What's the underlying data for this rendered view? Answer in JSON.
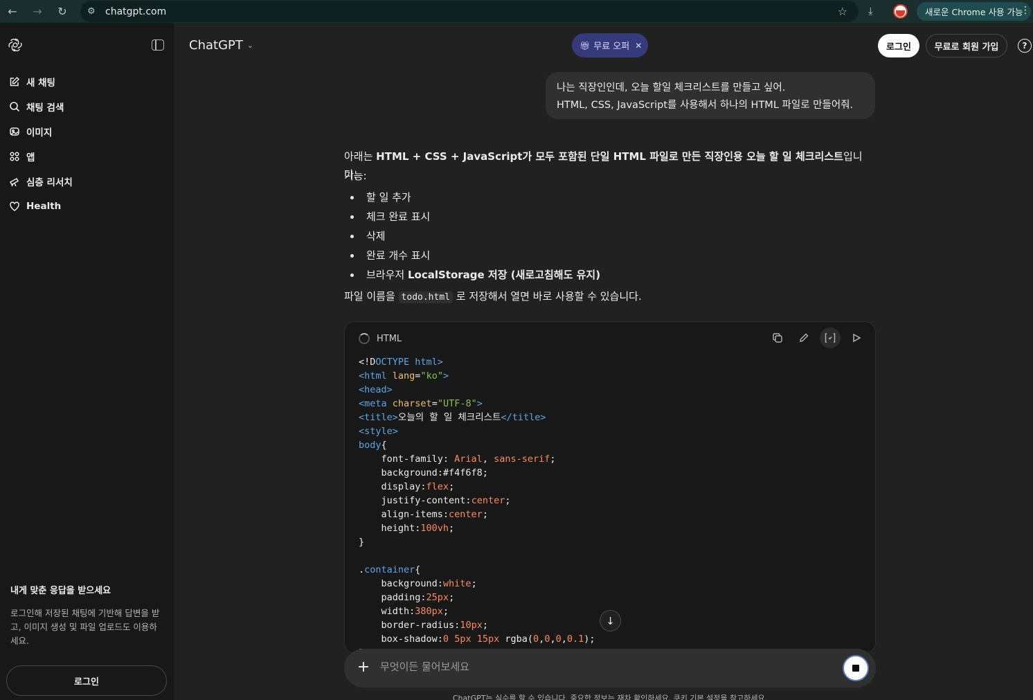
{
  "browser": {
    "url": "chatgpt.com",
    "update_label": "새로운 Chrome 사용 가능"
  },
  "sidebar": {
    "items": [
      {
        "label": "새 채팅",
        "icon": "edit-icon"
      },
      {
        "label": "채팅 검색",
        "icon": "search-icon"
      },
      {
        "label": "이미지",
        "icon": "image-icon"
      },
      {
        "label": "앱",
        "icon": "apps-icon"
      },
      {
        "label": "심층 리서치",
        "icon": "telescope-icon"
      },
      {
        "label": "Health",
        "icon": "heart-icon"
      }
    ],
    "promo_title": "내게 맞춘 응답을 받으세요",
    "promo_text": "로그인해 저장된 채팅에 기반해 답변을 받고, 이미지 생성 및 파일 업로드도 이용하세요.",
    "login_label": "로그인"
  },
  "header": {
    "title": "ChatGPT",
    "offer_label": "무료 오퍼",
    "login_label": "로그인",
    "signup_label": "무료로 회원 가입"
  },
  "chat": {
    "user_message": [
      "나는 직장인인데, 오늘 할일 체크리스트를 만들고 싶어.",
      "HTML, CSS, JavaScript를 사용해서 하나의 HTML 파일로 만들어줘."
    ],
    "answer": {
      "intro_prefix": "아래는 ",
      "intro_bold": "HTML + CSS + JavaScript가 모두 포함된 단일 HTML 파일로 만든 직장인용 오늘 할 일 체크리스트",
      "intro_suffix": "입니다.",
      "features_label": "기능:",
      "features": [
        "할 일 추가",
        "체크 완료 표시",
        "삭제",
        "완료 개수 표시"
      ],
      "feature_last_prefix": "브라우저 ",
      "feature_last_bold": "LocalStorage 저장 (새로고침해도 유지)",
      "filename_prefix": "파일 이름을 ",
      "filename": "todo.html",
      "filename_suffix": " 로 저장해서 열면 바로 사용할 수 있습니다."
    },
    "code": {
      "language": "HTML"
    }
  },
  "composer": {
    "placeholder": "무엇이든 물어보세요"
  },
  "disclaimer": "ChatGPT는 실수를 할 수 있습니다. 중요한 정보는 재차 확인하세요. 쿠키 기본 설정을 참고하세요."
}
